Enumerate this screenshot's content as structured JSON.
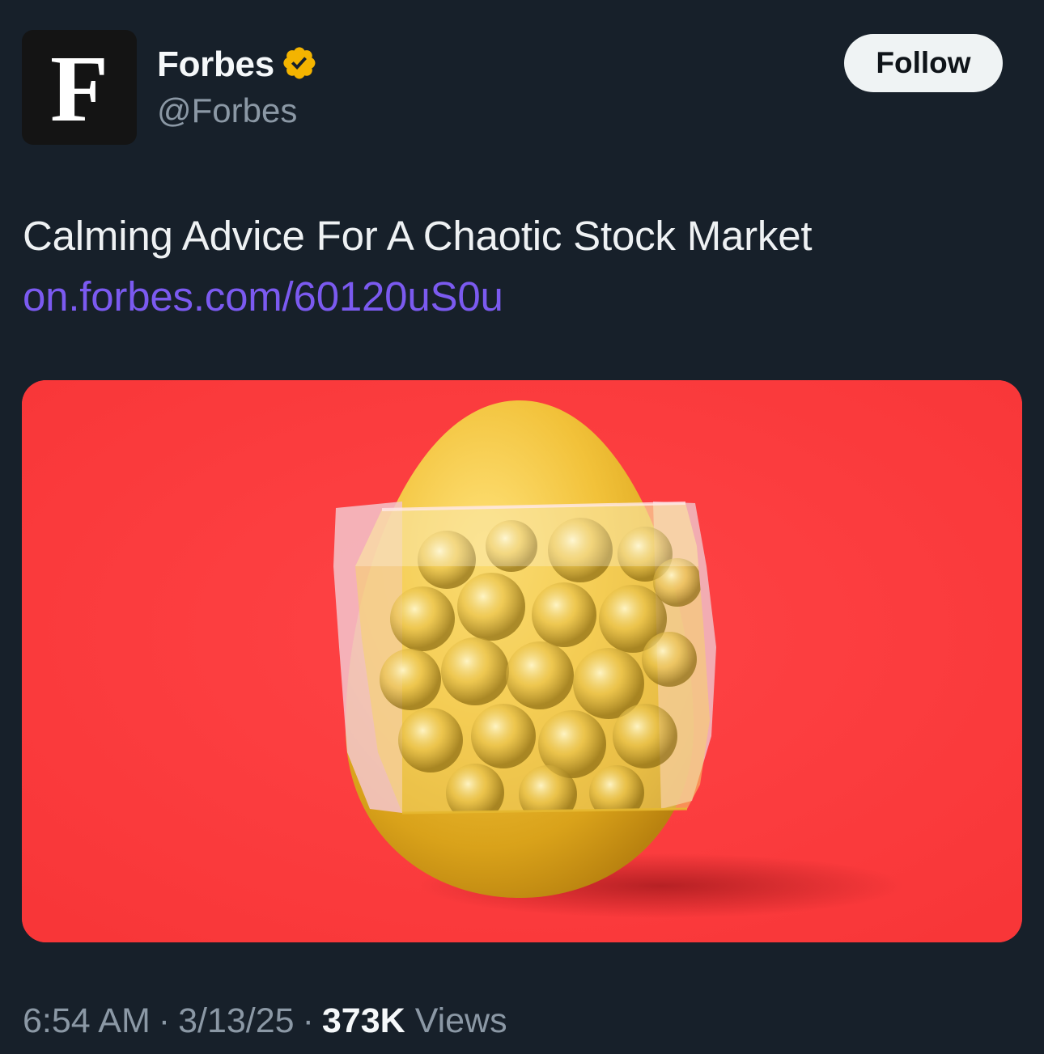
{
  "author": {
    "avatar_letter": "F",
    "display_name": "Forbes",
    "handle": "@Forbes",
    "verified_badge_icon": "verified-badge-icon",
    "verified_badge_color": "#f4b400"
  },
  "follow_button": {
    "label": "Follow"
  },
  "post": {
    "text": "Calming Advice For A Chaotic Stock Market",
    "link_text": "on.forbes.com/60120uS0u",
    "link_color": "#7b5af0"
  },
  "media": {
    "background_color": "#ff3c3e",
    "subject": "golden-egg-in-bubble-wrap-image"
  },
  "meta": {
    "time": "6:54 AM",
    "separator": "·",
    "date": "3/13/25",
    "views_count": "373K",
    "views_label": "Views"
  }
}
